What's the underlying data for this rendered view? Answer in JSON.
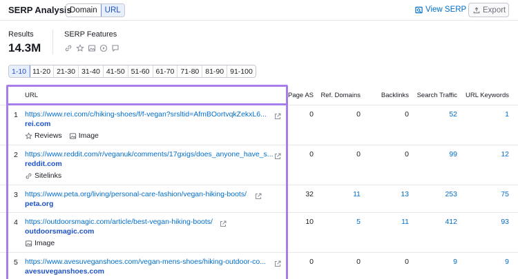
{
  "header": {
    "title": "SERP Analysis",
    "tabs": [
      {
        "label": "Domain"
      },
      {
        "label": "URL"
      }
    ],
    "view_serp_label": "View SERP",
    "export_label": "Export"
  },
  "summary": {
    "results_label": "Results",
    "results_value": "14.3M",
    "features_label": "SERP Features",
    "feature_icons": [
      "link-icon",
      "star-icon",
      "image-icon",
      "video-icon",
      "comment-icon"
    ]
  },
  "pagination": [
    "1-10",
    "11-20",
    "21-30",
    "31-40",
    "41-50",
    "51-60",
    "61-70",
    "71-80",
    "81-90",
    "91-100"
  ],
  "table": {
    "columns": [
      "URL",
      "Page AS",
      "Ref. Domains",
      "Backlinks",
      "Search Traffic",
      "URL Keywords"
    ],
    "rows": [
      {
        "num": "1",
        "url": "https://www.rei.com/c/hiking-shoes/f/f-vegan?srsltid=AfmBOortvqkZekxL6...",
        "domain": "rei.com",
        "features": [
          "Reviews",
          "Image"
        ],
        "page_as": "0",
        "ref_domains": "0",
        "backlinks": "0",
        "search_traffic": "52",
        "url_keywords": "1"
      },
      {
        "num": "2",
        "url": "https://www.reddit.com/r/veganuk/comments/17gxigs/does_anyone_have_s...",
        "domain": "reddit.com",
        "features": [
          "Sitelinks"
        ],
        "page_as": "0",
        "ref_domains": "0",
        "backlinks": "0",
        "search_traffic": "99",
        "url_keywords": "12"
      },
      {
        "num": "3",
        "url": "https://www.peta.org/living/personal-care-fashion/vegan-hiking-boots/",
        "domain": "peta.org",
        "features": [],
        "page_as": "32",
        "ref_domains": "11",
        "backlinks": "13",
        "search_traffic": "253",
        "url_keywords": "75"
      },
      {
        "num": "4",
        "url": "https://outdoorsmagic.com/article/best-vegan-hiking-boots/",
        "domain": "outdoorsmagic.com",
        "features": [
          "Image"
        ],
        "page_as": "10",
        "ref_domains": "5",
        "backlinks": "11",
        "search_traffic": "412",
        "url_keywords": "93"
      },
      {
        "num": "5",
        "url": "https://www.avesuveganshoes.com/vegan-mens-shoes/hiking-outdoor-co...",
        "domain": "avesuveganshoes.com",
        "features": [],
        "page_as": "0",
        "ref_domains": "0",
        "backlinks": "0",
        "search_traffic": "9",
        "url_keywords": "9"
      }
    ]
  },
  "colors": {
    "accent": "#006dca",
    "highlight": "#a77dec"
  }
}
